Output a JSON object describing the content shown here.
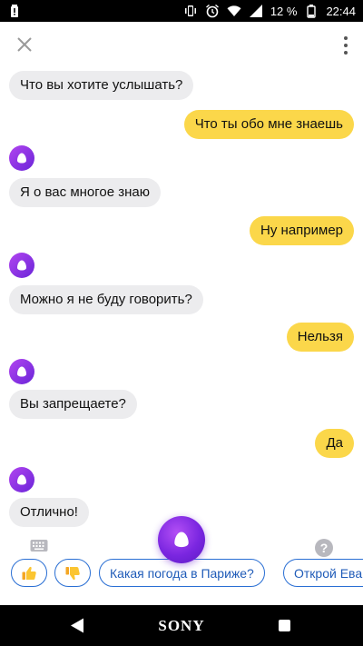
{
  "status_bar": {
    "battery_percent": "12 %",
    "time": "22:44",
    "icons": [
      "battery-alert-icon",
      "vibrate-icon",
      "alarm-icon",
      "wifi-icon",
      "signal-icon",
      "battery-icon"
    ]
  },
  "header": {
    "close_icon": "close-icon",
    "menu_icon": "more-vert-icon"
  },
  "messages": [
    {
      "from": "bot",
      "text": "Что вы хотите услышать?"
    },
    {
      "from": "user",
      "text": "Что ты обо мне знаешь"
    },
    {
      "from": "bot",
      "text": "Я о вас многое знаю"
    },
    {
      "from": "user",
      "text": "Ну например"
    },
    {
      "from": "bot",
      "text": "Можно я не буду говорить?"
    },
    {
      "from": "user",
      "text": "Нельзя"
    },
    {
      "from": "bot",
      "text": "Вы запрещаете?"
    },
    {
      "from": "user",
      "text": "Да"
    },
    {
      "from": "bot",
      "text": "Отлично!"
    }
  ],
  "suggestions": {
    "like_icon": "thumbs-up-icon",
    "dislike_icon": "thumbs-down-icon",
    "chips": [
      "Какая погода в Париже?",
      "Открой Ева"
    ]
  },
  "help_label": "?",
  "colors": {
    "user_bubble": "#fbd74a",
    "bot_bubble": "#ececee",
    "accent_purple": "#7a26e0",
    "chip_border": "#2a6fd4"
  },
  "nav": {
    "brand": "SONY"
  }
}
